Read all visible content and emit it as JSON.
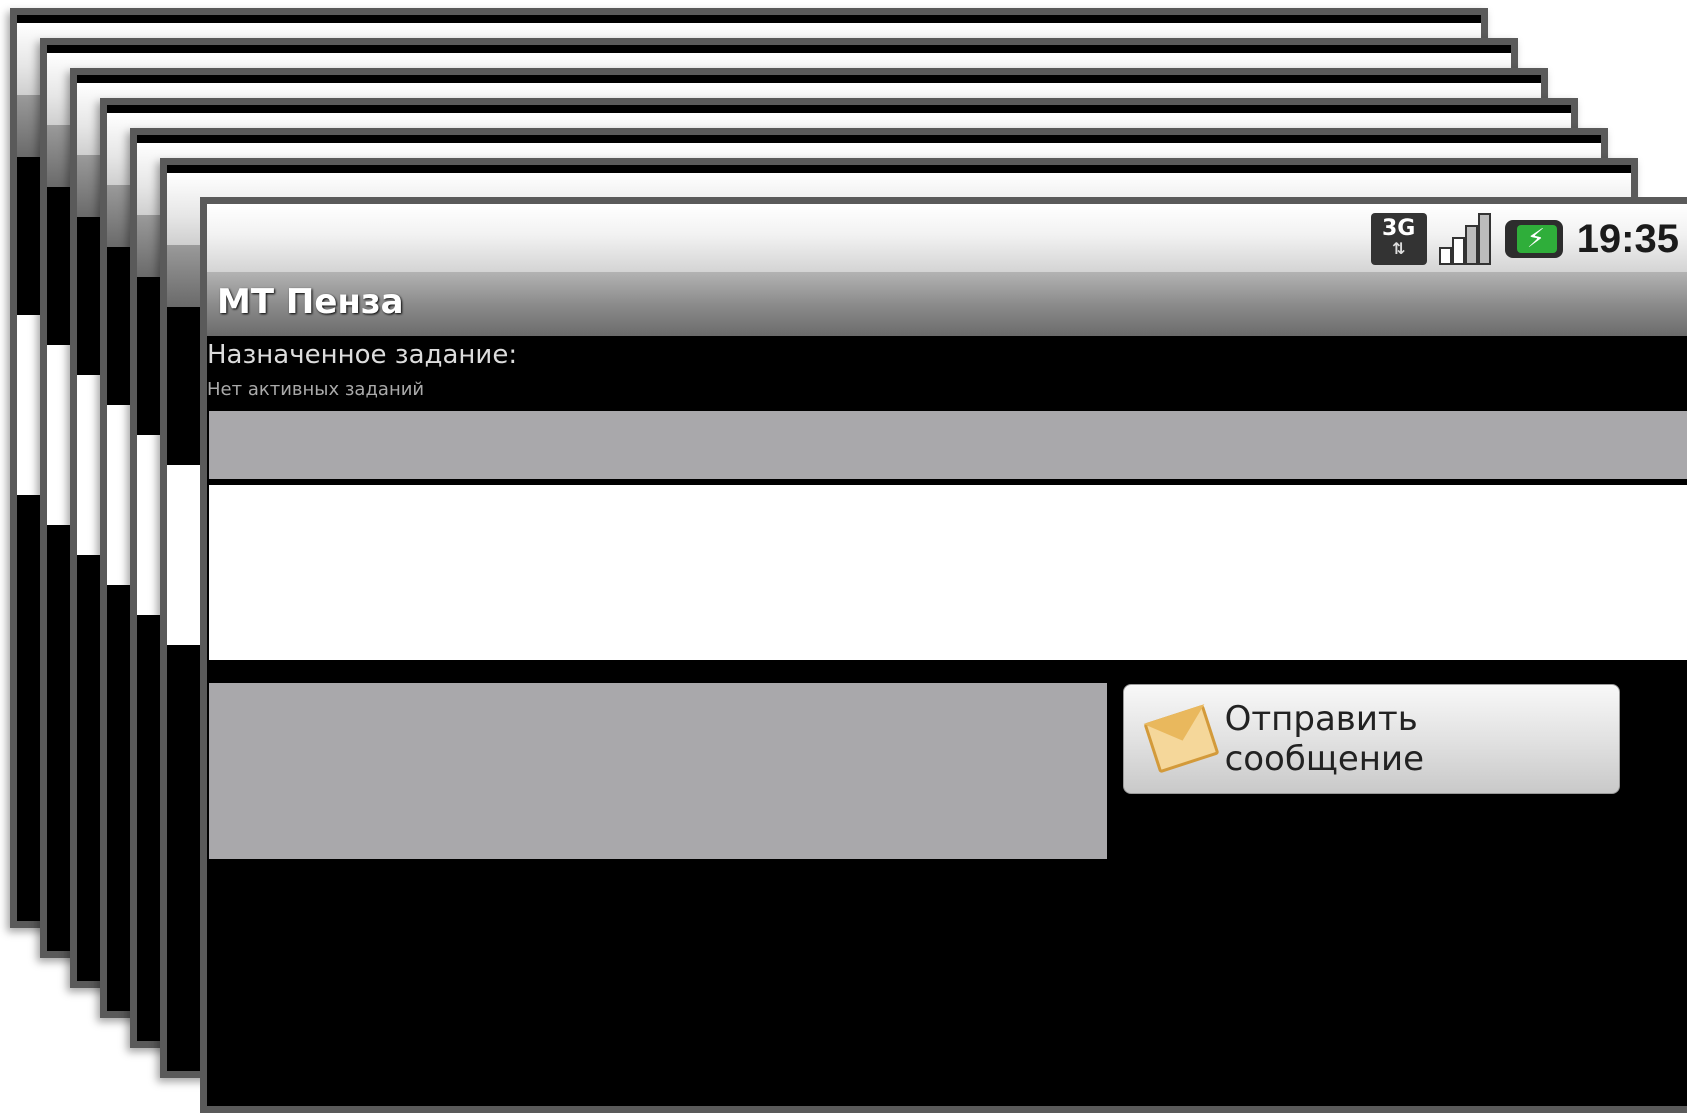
{
  "status_bar": {
    "network_label": "3G",
    "time": "19:35",
    "icons": [
      "3g-icon",
      "signal-icon",
      "battery-charging-icon"
    ]
  },
  "app": {
    "title": "МТ Пенза"
  },
  "task": {
    "label": "Назначенное задание:",
    "value": "Нет активных заданий"
  },
  "actions": {
    "send_label": "Отправить сообщение",
    "send_icon": "envelope-icon"
  },
  "colors": {
    "background": "#000000",
    "panel_gray": "#a9a8ab",
    "title_gray": "#8c8c8c"
  }
}
